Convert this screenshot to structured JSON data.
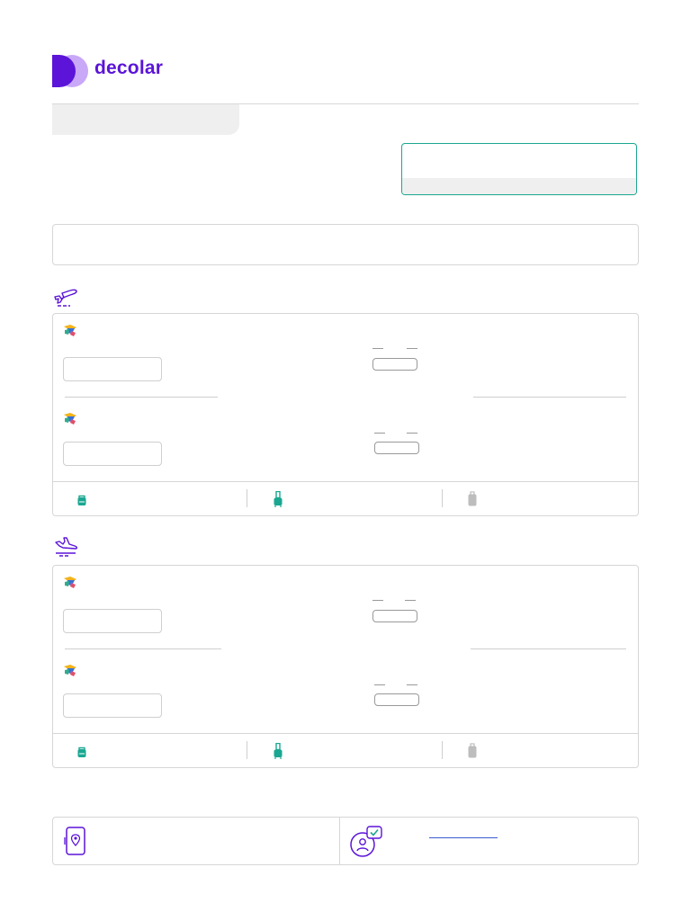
{
  "brand": {
    "name": "decolar",
    "color": "#5b14d8",
    "mark_color_light": "#c9a8f7"
  },
  "colors": {
    "accent_teal": "#1aa791",
    "icon_purple": "#5b14d8",
    "link_blue": "#3b5ccc",
    "border": "#d6d6d6",
    "skeleton": "#efefef"
  },
  "legs": [
    {
      "direction": "outbound",
      "icon": "plane-takeoff-icon",
      "segments": [
        {
          "airline_icon": "airline-logo-icon"
        },
        {
          "airline_icon": "airline-logo-icon"
        }
      ],
      "baggage": [
        {
          "icon": "personal-item-icon",
          "included": true
        },
        {
          "icon": "carry-on-icon",
          "included": true
        },
        {
          "icon": "checked-bag-icon",
          "included": false
        }
      ]
    },
    {
      "direction": "return",
      "icon": "plane-landing-icon",
      "segments": [
        {
          "airline_icon": "airline-logo-icon"
        },
        {
          "airline_icon": "airline-logo-icon"
        }
      ],
      "baggage": [
        {
          "icon": "personal-item-icon",
          "included": true
        },
        {
          "icon": "carry-on-icon",
          "included": true
        },
        {
          "icon": "checked-bag-icon",
          "included": false
        }
      ]
    }
  ],
  "info": {
    "left_icon": "phone-location-icon",
    "right_icon": "person-verified-icon",
    "link_text": ""
  }
}
